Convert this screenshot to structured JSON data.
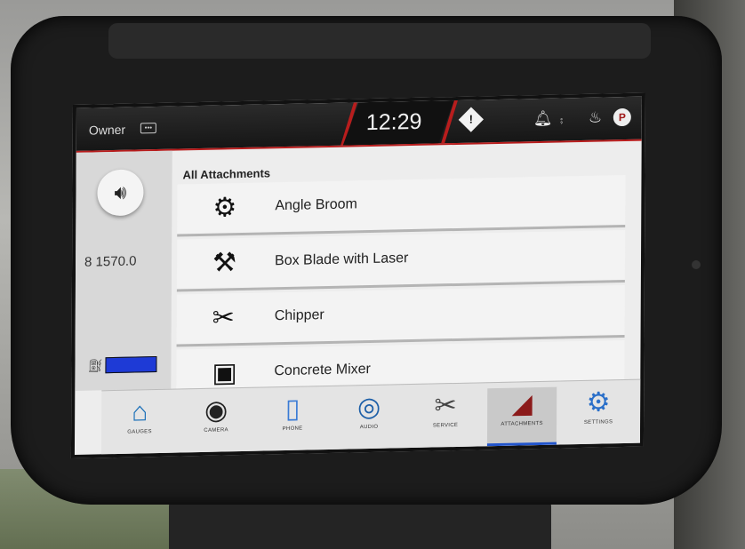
{
  "status": {
    "user": "Owner",
    "user_icon": "keypad-icon",
    "time": "12:29",
    "warning": "!",
    "indicators": [
      "alarm-icon",
      "tilt-icon",
      "temp-icon",
      "parking-brake-icon"
    ],
    "parking_label": "P"
  },
  "left_panel": {
    "volume_icon": "speaker-icon",
    "hours": "8 1570.0",
    "fuel_level": 1.0
  },
  "list": {
    "title": "All Attachments",
    "items": [
      {
        "label": "Angle Broom"
      },
      {
        "label": "Box Blade with Laser"
      },
      {
        "label": "Chipper"
      },
      {
        "label": "Concrete Mixer"
      }
    ]
  },
  "nav": {
    "items": [
      {
        "label": "GAUGES",
        "icon": "home-icon"
      },
      {
        "label": "CAMERA",
        "icon": "camera-icon"
      },
      {
        "label": "PHONE",
        "icon": "phone-icon"
      },
      {
        "label": "AUDIO",
        "icon": "audio-icon"
      },
      {
        "label": "SERVICE",
        "icon": "tools-icon"
      },
      {
        "label": "ATTACHMENTS",
        "icon": "bucket-icon",
        "active": true
      },
      {
        "label": "SETTINGS",
        "icon": "gear-icon"
      }
    ]
  },
  "colors": {
    "accent_red": "#b81d1d",
    "fuel_blue": "#1e3ad6",
    "active_underline": "#2255cc"
  }
}
